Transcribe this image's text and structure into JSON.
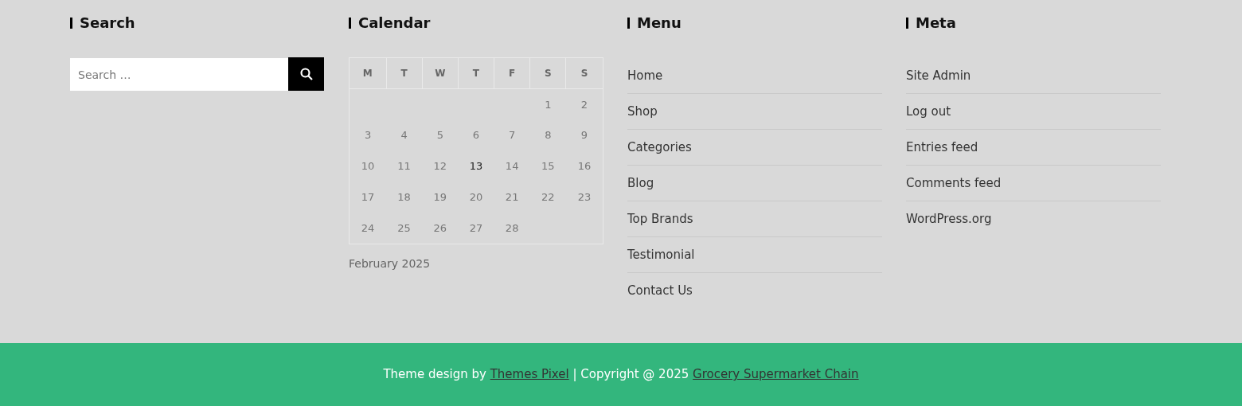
{
  "search": {
    "title": "Search",
    "placeholder": "Search …"
  },
  "calendar": {
    "title": "Calendar",
    "weekdays": [
      "M",
      "T",
      "W",
      "T",
      "F",
      "S",
      "S"
    ],
    "weeks": [
      [
        {
          "kind": "empty"
        },
        {
          "kind": "empty"
        },
        {
          "kind": "empty"
        },
        {
          "kind": "empty"
        },
        {
          "kind": "empty"
        },
        {
          "kind": "day",
          "day": "1",
          "today": false
        },
        {
          "kind": "day",
          "day": "2",
          "today": false
        }
      ],
      [
        {
          "kind": "day",
          "day": "3",
          "today": false
        },
        {
          "kind": "day",
          "day": "4",
          "today": false
        },
        {
          "kind": "day",
          "day": "5",
          "today": false
        },
        {
          "kind": "day",
          "day": "6",
          "today": false
        },
        {
          "kind": "day",
          "day": "7",
          "today": false
        },
        {
          "kind": "day",
          "day": "8",
          "today": false
        },
        {
          "kind": "day",
          "day": "9",
          "today": false
        }
      ],
      [
        {
          "kind": "day",
          "day": "10",
          "today": false
        },
        {
          "kind": "day",
          "day": "11",
          "today": false
        },
        {
          "kind": "day",
          "day": "12",
          "today": false
        },
        {
          "kind": "day",
          "day": "13",
          "today": true
        },
        {
          "kind": "day",
          "day": "14",
          "today": false
        },
        {
          "kind": "day",
          "day": "15",
          "today": false
        },
        {
          "kind": "day",
          "day": "16",
          "today": false
        }
      ],
      [
        {
          "kind": "day",
          "day": "17",
          "today": false
        },
        {
          "kind": "day",
          "day": "18",
          "today": false
        },
        {
          "kind": "day",
          "day": "19",
          "today": false
        },
        {
          "kind": "day",
          "day": "20",
          "today": false
        },
        {
          "kind": "day",
          "day": "21",
          "today": false
        },
        {
          "kind": "day",
          "day": "22",
          "today": false
        },
        {
          "kind": "day",
          "day": "23",
          "today": false
        }
      ],
      [
        {
          "kind": "day",
          "day": "24",
          "today": false
        },
        {
          "kind": "day",
          "day": "25",
          "today": false
        },
        {
          "kind": "day",
          "day": "26",
          "today": false
        },
        {
          "kind": "day",
          "day": "27",
          "today": false
        },
        {
          "kind": "day",
          "day": "28",
          "today": false
        },
        {
          "kind": "empty"
        },
        {
          "kind": "empty"
        }
      ]
    ],
    "caption": "February 2025"
  },
  "menu": {
    "title": "Menu",
    "items": [
      "Home",
      "Shop",
      "Categories",
      "Blog",
      "Top Brands",
      "Testimonial",
      "Contact Us"
    ]
  },
  "meta": {
    "title": "Meta",
    "items": [
      "Site Admin",
      "Log out",
      "Entries feed",
      "Comments feed",
      "WordPress.org"
    ]
  },
  "footer": {
    "prefix": "Theme design by",
    "link_1": "Themes Pixel",
    "middle": "| Copyright @ 2025",
    "link_2": "Grocery Supermarket Chain"
  }
}
